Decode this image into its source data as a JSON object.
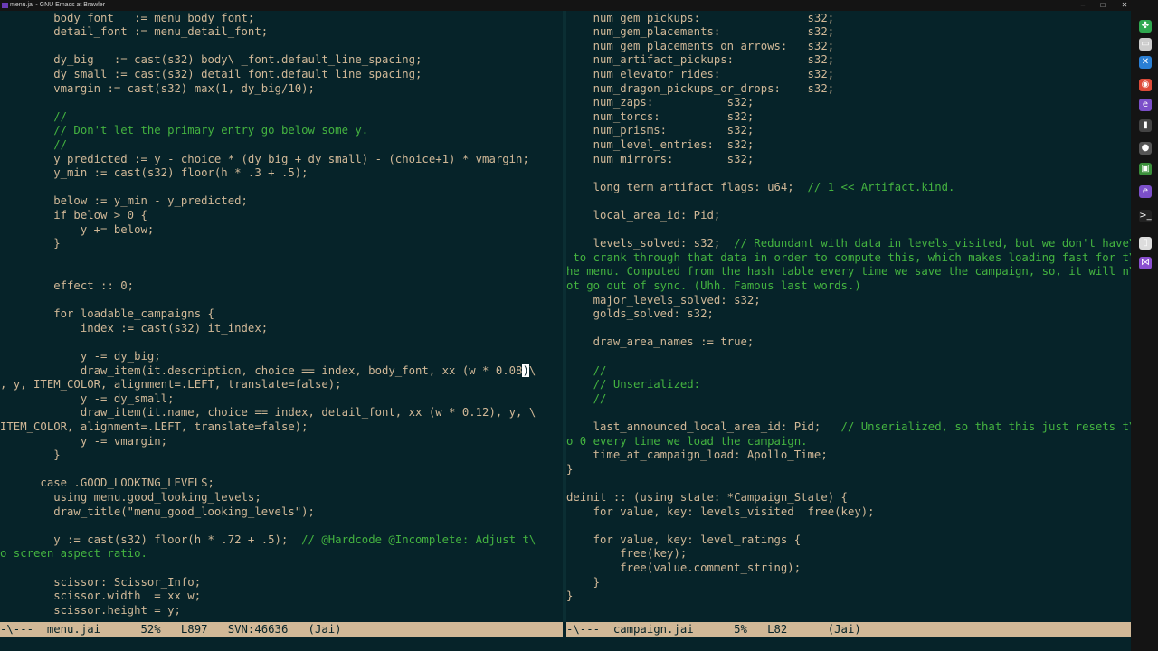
{
  "window": {
    "title": "menu.jai - GNU Emacs at Brawler",
    "minimize": "–",
    "maximize": "□",
    "close": "✕"
  },
  "left_pane": {
    "lines": [
      {
        "text": "        body_font   := menu_body_font;"
      },
      {
        "text": "        detail_font := menu_detail_font;"
      },
      {
        "text": ""
      },
      {
        "text": "        dy_big   := cast(s32) body\\ _font.default_line_spacing;"
      },
      {
        "text": "        dy_small := cast(s32) detail_font.default_line_spacing;"
      },
      {
        "text": "        vmargin := cast(s32) max(1, dy_big/10);"
      },
      {
        "text": ""
      },
      {
        "text": "        //",
        "comment": true
      },
      {
        "text": "        // Don't let the primary entry go below some y.",
        "comment": true
      },
      {
        "text": "        //",
        "comment": true
      },
      {
        "text": "        y_predicted := y - choice * (dy_big + dy_small) - (choice+1) * vmargin;"
      },
      {
        "text": "        y_min := cast(s32) floor(h * .3 + .5);"
      },
      {
        "text": ""
      },
      {
        "text": "        below := y_min - y_predicted;"
      },
      {
        "text": "        if below > 0 {"
      },
      {
        "text": "            y += below;"
      },
      {
        "text": "        }"
      },
      {
        "text": ""
      },
      {
        "text": ""
      },
      {
        "text": "        effect :: 0;"
      },
      {
        "text": ""
      },
      {
        "text": "        for loadable_campaigns {"
      },
      {
        "text": "            index := cast(s32) it_index;"
      },
      {
        "text": ""
      },
      {
        "text": "            y -= dy_big;"
      },
      {
        "text": "            draw_item(it.description, choice == index, body_font, xx (w * 0.08",
        "cursor": ")",
        "after": "\\"
      },
      {
        "text": ", y, ITEM_COLOR, alignment=.LEFT, translate=false);"
      },
      {
        "text": "            y -= dy_small;"
      },
      {
        "text": "            draw_item(it.name, choice == index, detail_font, xx (w * 0.12), y, \\"
      },
      {
        "text": "ITEM_COLOR, alignment=.LEFT, translate=false);"
      },
      {
        "text": "            y -= vmargin;"
      },
      {
        "text": "        }"
      },
      {
        "text": ""
      },
      {
        "text": "      case .GOOD_LOOKING_LEVELS;"
      },
      {
        "text": "        using menu.good_looking_levels;"
      },
      {
        "text": "        draw_title(\"menu_good_looking_levels\");"
      },
      {
        "text": ""
      },
      {
        "text": "        y := cast(s32) floor(h * .72 + .5);  ",
        "tail": "// @Hardcode @Incomplete: Adjust t\\"
      },
      {
        "text": "o screen aspect ratio.",
        "comment": true
      },
      {
        "text": ""
      },
      {
        "text": "        scissor: Scissor_Info;"
      },
      {
        "text": "        scissor.width  = xx w;"
      },
      {
        "text": "        scissor.height = y;"
      }
    ],
    "modeline": "-\\---  menu.jai      52%   L897   SVN:46636   (Jai)"
  },
  "right_pane": {
    "lines": [
      {
        "text": "    num_gem_pickups:                s32;"
      },
      {
        "text": "    num_gem_placements:             s32;"
      },
      {
        "text": "    num_gem_placements_on_arrows:   s32;"
      },
      {
        "text": "    num_artifact_pickups:           s32;"
      },
      {
        "text": "    num_elevator_rides:             s32;"
      },
      {
        "text": "    num_dragon_pickups_or_drops:    s32;"
      },
      {
        "text": "    num_zaps:           s32;"
      },
      {
        "text": "    num_torcs:          s32;"
      },
      {
        "text": "    num_prisms:         s32;"
      },
      {
        "text": "    num_level_entries:  s32;"
      },
      {
        "text": "    num_mirrors:        s32;"
      },
      {
        "text": ""
      },
      {
        "text": "    long_term_artifact_flags: u64;  ",
        "tail": "// 1 << Artifact.kind."
      },
      {
        "text": ""
      },
      {
        "text": "    local_area_id: Pid;"
      },
      {
        "text": ""
      },
      {
        "text": "    levels_solved: s32;  ",
        "tail": "// Redundant with data in levels_visited, but we don't have\\"
      },
      {
        "text": " to crank through that data in order to compute this, which makes loading fast for t\\",
        "comment": true
      },
      {
        "text": "he menu. Computed from the hash table every time we save the campaign, so, it will n\\",
        "comment": true
      },
      {
        "text": "ot go out of sync. (Uhh. Famous last words.)",
        "comment": true
      },
      {
        "text": "    major_levels_solved: s32;"
      },
      {
        "text": "    golds_solved: s32;"
      },
      {
        "text": ""
      },
      {
        "text": "    draw_area_names := true;"
      },
      {
        "text": ""
      },
      {
        "text": "    //",
        "comment": true
      },
      {
        "text": "    // Unserialized:",
        "comment": true
      },
      {
        "text": "    //",
        "comment": true
      },
      {
        "text": ""
      },
      {
        "text": "    last_announced_local_area_id: Pid;   ",
        "tail": "// Unserialized, so that this just resets t\\"
      },
      {
        "text": "o 0 every time we load the campaign.",
        "comment": true
      },
      {
        "text": "    time_at_campaign_load: Apollo_Time;"
      },
      {
        "text": "}"
      },
      {
        "text": ""
      },
      {
        "text": "deinit :: (using state: *Campaign_State) {"
      },
      {
        "text": "    for value, key: levels_visited  free(key);"
      },
      {
        "text": ""
      },
      {
        "text": "    for value, key: level_ratings {"
      },
      {
        "text": "        free(key);"
      },
      {
        "text": "        free(value.comment_string);"
      },
      {
        "text": "    }"
      },
      {
        "text": "}"
      }
    ],
    "modeline": "-\\---  campaign.jai      5%   L82      (Jai)"
  },
  "colors": {
    "background": "#062329",
    "text": "#d1b897",
    "comment": "#44b340",
    "modeline": "#d1b897"
  },
  "taskbar_icons": [
    {
      "name": "clover-icon",
      "glyph": "✤",
      "color": "#2fa84f"
    },
    {
      "name": "window-icon",
      "glyph": "▭",
      "color": "#cccccc"
    },
    {
      "name": "x-app-icon",
      "glyph": "✕",
      "color": "#2a7fd4"
    },
    {
      "name": "chrome-icon",
      "glyph": "◉",
      "color": "#dd4b39"
    },
    {
      "name": "emacs-icon",
      "glyph": "e",
      "color": "#7b4fc9"
    },
    {
      "name": "terminal-icon",
      "glyph": "▮",
      "color": "#444444"
    },
    {
      "name": "obs-icon",
      "glyph": "●",
      "color": "#555555"
    },
    {
      "name": "app-icon",
      "glyph": "▣",
      "color": "#3a8f3a"
    },
    {
      "name": "emacs-icon-2",
      "glyph": "e",
      "color": "#7b4fc9"
    },
    {
      "name": "console-icon",
      "glyph": ">_",
      "color": "#222222"
    },
    {
      "name": "document-icon",
      "glyph": "▯",
      "color": "#dddddd"
    },
    {
      "name": "visual-studio-icon",
      "glyph": "⋈",
      "color": "#8a4fd0"
    }
  ]
}
